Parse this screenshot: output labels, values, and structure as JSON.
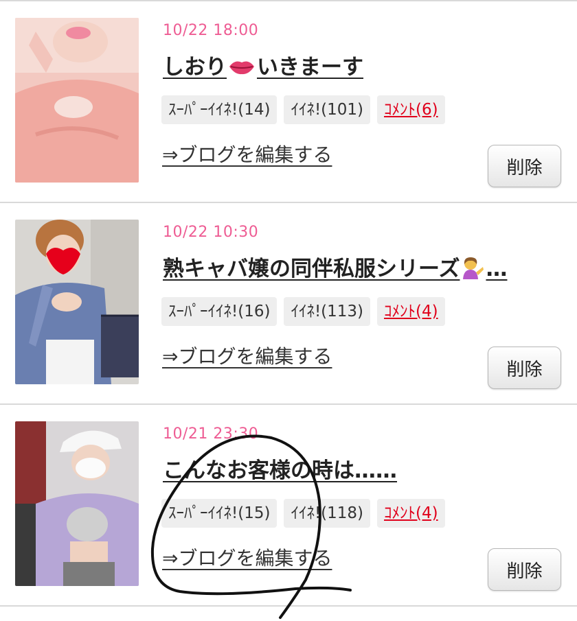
{
  "entries": [
    {
      "date": "10/22 18:00",
      "title": "しおり",
      "title_emoji": "lips-icon",
      "title_suffix": "いきまーす",
      "super_like": "ｽｰﾊﾟｰｲｲﾈ!(14)",
      "like": "ｲｲﾈ!(101)",
      "comment": "ｺﾒﾝﾄ(6)",
      "edit_link": "⇒ブログを編集する",
      "delete_label": "削除"
    },
    {
      "date": "10/22 10:30",
      "title": "熟キャバ嬢の同伴私服シリーズ",
      "title_emoji": "person-tipping-hand-icon",
      "title_suffix": "…",
      "super_like": "ｽｰﾊﾟｰｲｲﾈ!(16)",
      "like": "ｲｲﾈ!(113)",
      "comment": "ｺﾒﾝﾄ(4)",
      "edit_link": "⇒ブログを編集する",
      "delete_label": "削除"
    },
    {
      "date": "10/21 23:30",
      "title": "こんなお客様の時は……",
      "super_like": "ｽｰﾊﾟｰｲｲﾈ!(15)",
      "like": "ｲｲﾈ!(118)",
      "comment": "ｺﾒﾝﾄ(4)",
      "edit_link": "⇒ブログを編集する",
      "delete_label": "削除"
    }
  ],
  "colors": {
    "date": "#ee5c93",
    "comment": "#e0001b",
    "divider": "#d9d9d9",
    "badge_bg": "#eeeeee"
  }
}
